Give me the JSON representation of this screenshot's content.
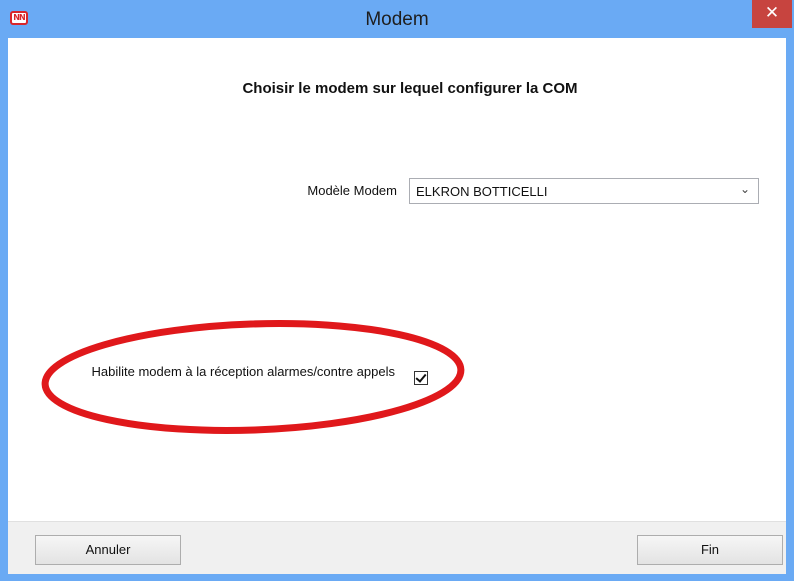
{
  "window": {
    "title": "Modem",
    "app_icon_text": "NN",
    "close_glyph": "✕"
  },
  "main": {
    "heading": "Choisir le modem sur lequel configurer la COM",
    "modem_label": "Modèle Modem",
    "modem_value": "ELKRON BOTTICELLI",
    "arrow_glyph": "⌄",
    "checkbox_label": "Habilite modem à la réception alarmes/contre appels",
    "checkbox_checked": true
  },
  "footer": {
    "cancel_label": "Annuler",
    "finish_label": "Fin"
  },
  "colors": {
    "titlebar": "#6aaaf4",
    "close": "#c7443f",
    "annotation": "#e0181b"
  }
}
